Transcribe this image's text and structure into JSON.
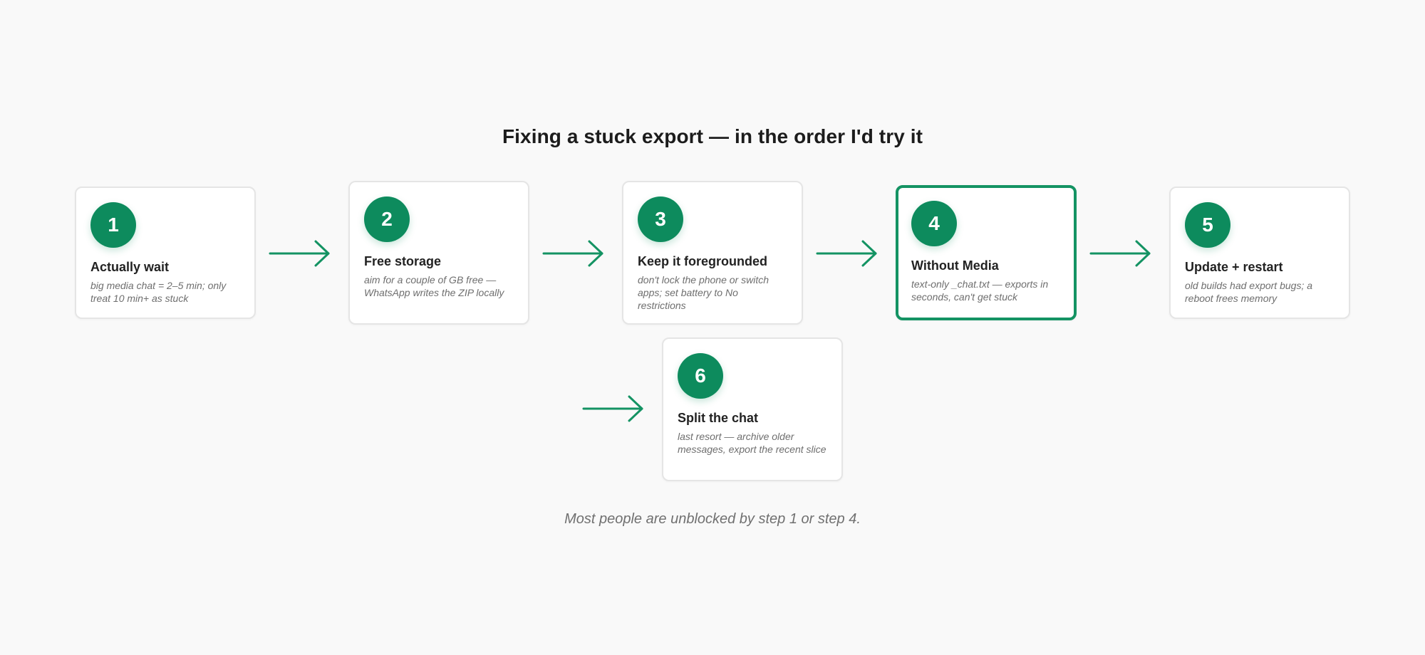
{
  "title": "Fixing a stuck export — in the order I'd try it",
  "accent_color": "#0d8b5d",
  "steps": [
    {
      "number": "1",
      "title": "Actually wait",
      "description": "big media chat = 2–5 min; only treat 10 min+ as stuck",
      "highlighted": false
    },
    {
      "number": "2",
      "title": "Free storage",
      "description": "aim for a couple of GB free — WhatsApp writes the ZIP locally",
      "highlighted": false
    },
    {
      "number": "3",
      "title": "Keep it foregrounded",
      "description": "don't lock the phone or switch apps; set battery to No restrictions",
      "highlighted": false
    },
    {
      "number": "4",
      "title": "Without Media",
      "description": "text-only _chat.txt — exports in seconds, can't get stuck",
      "highlighted": true
    },
    {
      "number": "5",
      "title": "Update + restart",
      "description": "old builds had export bugs; a reboot frees memory",
      "highlighted": false
    },
    {
      "number": "6",
      "title": "Split the chat",
      "description": "last resort — archive older messages, export the recent slice",
      "highlighted": false
    }
  ],
  "footnote": "Most people are unblocked by step 1 or step 4."
}
